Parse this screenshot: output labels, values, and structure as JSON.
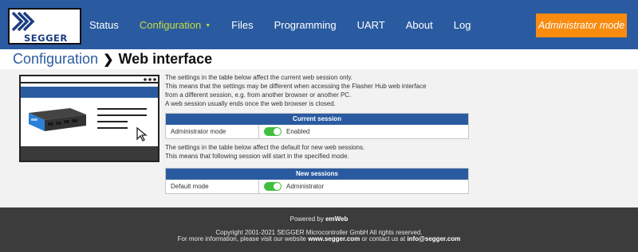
{
  "header": {
    "logo_text": "SEGGER",
    "nav": [
      {
        "label": "Status",
        "active": false
      },
      {
        "label": "Configuration",
        "active": true
      },
      {
        "label": "Files",
        "active": false
      },
      {
        "label": "Programming",
        "active": false
      },
      {
        "label": "UART",
        "active": false
      },
      {
        "label": "About",
        "active": false
      },
      {
        "label": "Log",
        "active": false
      }
    ],
    "admin_button": "Administrator mode"
  },
  "breadcrumb": {
    "parent": "Configuration",
    "current": "Web interface"
  },
  "content": {
    "intro_lines": [
      "The settings in the table below affect the current web session only.",
      "This means that the settings may be different when accessing the Flasher Hub web interface",
      "from a different session, e.g. from another browser or another PC.",
      "A web session usually ends once the web browser is closed."
    ],
    "current_session": {
      "title": "Current session",
      "row_label": "Administrator mode",
      "row_value": "Enabled",
      "toggle_on": true
    },
    "default_lines": [
      "The settings in the table below affect the default for new web sessions.",
      "This means that following session will start in the specified mode."
    ],
    "new_sessions": {
      "title": "New sessions",
      "row_label": "Default mode",
      "row_value": "Administrator",
      "toggle_on": true
    }
  },
  "footer": {
    "powered_prefix": "Powered by ",
    "powered_brand": "emWeb",
    "copyright": "Copyright 2001-2021 SEGGER Microcontroller GmbH All rights reserved.",
    "info_prefix": "For more information, please visit our website ",
    "website": "www.segger.com",
    "info_middle": " or contact us at ",
    "email": "info@segger.com"
  },
  "colors": {
    "brand_blue": "#2a5ba0",
    "admin_orange": "#f98b0f",
    "active_nav": "#c8dc3c",
    "toggle_green": "#3fbf3f",
    "footer_bg": "#3c3c3c"
  }
}
